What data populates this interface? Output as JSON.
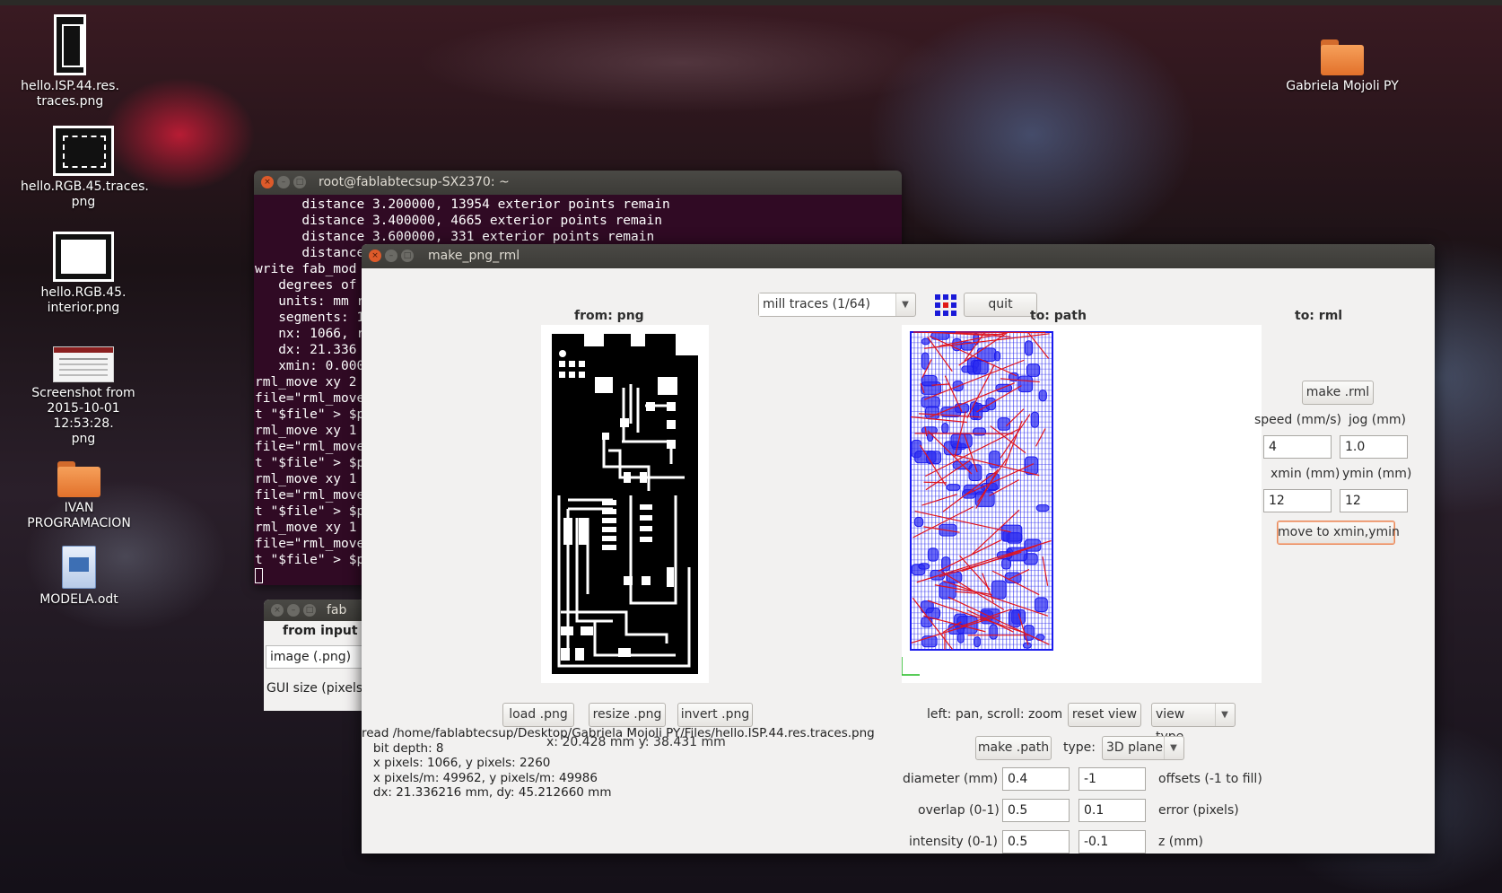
{
  "desktop": {
    "icons": [
      {
        "label": "hello.ISP.44.res.\ntraces.png",
        "icon": "pcb-thumbnail-icon"
      },
      {
        "label": "hello.RGB.45.traces.\npng",
        "icon": "pcb-thumbnail-icon"
      },
      {
        "label": "hello.RGB.45.\ninterior.png",
        "icon": "image-thumbnail-icon"
      },
      {
        "label": "Screenshot from\n2015-10-01 12:53:28.\npng",
        "icon": "screenshot-thumbnail-icon"
      },
      {
        "label": "IVAN\nPROGRAMACION",
        "icon": "folder-icon"
      },
      {
        "label": "MODELA.odt",
        "icon": "document-icon"
      },
      {
        "label": "Gabriela Mojoli PY",
        "icon": "folder-icon"
      }
    ]
  },
  "terminal": {
    "title": "root@fablabtecsup-SX2370: ~",
    "lines": [
      "      distance 3.200000, 13954 exterior points remain",
      "      distance 3.400000, 4665 exterior points remain",
      "      distance 3.600000, 331 exterior points remain",
      "      distance",
      "write fab_mod",
      "   degrees of",
      "   units: mm r",
      "   segments: 1",
      "   nx: 1066, r",
      "   dx: 21.336",
      "   xmin: 0.000",
      "rml_move xy 2",
      "file=\"rml_move",
      "t \"$file\" > $p",
      "rml_move xy 1",
      "file=\"rml_move",
      "t \"$file\" > $p",
      "rml_move xy 1",
      "file=\"rml_move",
      "t \"$file\" > $p",
      "rml_move xy 1",
      "file=\"rml_move",
      "t \"$file\" > $p"
    ]
  },
  "fab_window": {
    "title": "fab",
    "header": "from input f",
    "select_value": "image (.png)",
    "gui_size_label": "GUI size (pixels):"
  },
  "main_window": {
    "title": "make_png_rml",
    "process_select": "mill traces (1/64)",
    "quit_label": "quit",
    "from_png_header": "from: png",
    "to_path_header": "to: path",
    "to_rml_header": "to: rml",
    "load_png": "load .png",
    "resize_png": "resize .png",
    "invert_png": "invert .png",
    "coords": "x: 20.428 mm  y: 38.431 mm",
    "read_log": "read /home/fablabtecsup/Desktop/Gabriela Mojoli PY/Files/hello.ISP.44.res.traces.png\n   bit depth: 8\n   x pixels: 1066, y pixels: 2260\n   x pixels/m: 49962, y pixels/m: 49986\n   dx: 21.336216 mm, dy: 45.212660 mm",
    "pan_hint": "left: pan, scroll: zoom",
    "reset_view": "reset view",
    "view_type": "view type",
    "make_path": "make .path",
    "type_label": "type:",
    "type_value": "3D plane",
    "diameter_label": "diameter (mm)",
    "diameter_value": "0.4",
    "offsets_value": "-1",
    "offsets_label": "offsets (-1 to fill)",
    "overlap_label": "overlap (0-1)",
    "overlap_value": "0.5",
    "error_value": "0.1",
    "error_label": "error (pixels)",
    "intensity_label": "intensity (0-1)",
    "intensity_value": "0.5",
    "z_value": "-0.1",
    "z_label": "z (mm)",
    "make_rml": "make .rml",
    "speed_label": "speed (mm/s)",
    "jog_label": "jog (mm)",
    "speed_value": "4",
    "jog_value": "1.0",
    "xmin_label": "xmin (mm)",
    "ymin_label": "ymin (mm)",
    "xmin_value": "12",
    "ymin_value": "12",
    "move_to": "move to xmin,ymin"
  },
  "colors": {
    "terminal_bg": "#300a24",
    "path_blue": "#1a1aee",
    "path_red": "#e0141e",
    "highlight_border": "#e98a5c"
  }
}
